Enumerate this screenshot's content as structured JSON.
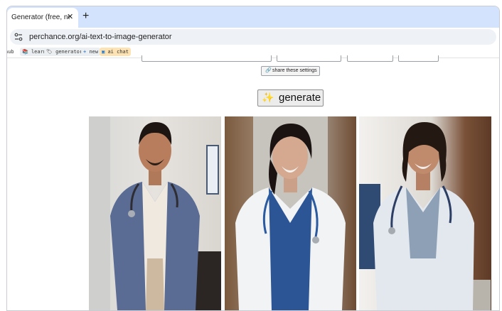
{
  "browser": {
    "tab": {
      "title": "Generator (free, no sig",
      "close_glyph": "✕"
    },
    "new_tab_glyph": "+",
    "url": "perchance.org/ai-text-to-image-generator"
  },
  "bookmarks": [
    {
      "label": "hub",
      "icon": "none"
    },
    {
      "label": "learn",
      "icon": "book-icon"
    },
    {
      "label": "generators",
      "icon": "tag-icon"
    },
    {
      "label": "new",
      "icon": "plus-icon"
    },
    {
      "label": "ai chat",
      "icon": "chat-icon"
    }
  ],
  "page": {
    "share_button": {
      "icon": "🔗",
      "label": "share these settings"
    },
    "generate_button": {
      "icon": "✨",
      "label": "generate"
    },
    "images": [
      {
        "subject": "doctor-man-blue-coat"
      },
      {
        "subject": "doctor-woman-white-coat"
      },
      {
        "subject": "doctor-man-long-hair"
      }
    ]
  },
  "colors": {
    "tabstrip": "#d3e3fd",
    "omnibox": "#eef1f6",
    "chat_bookmark": "#fde3b3"
  }
}
